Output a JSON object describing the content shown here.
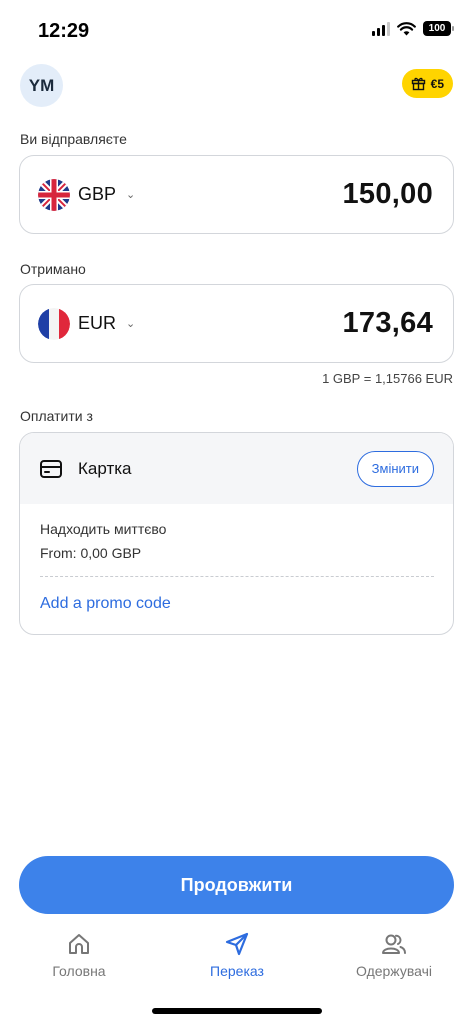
{
  "status_bar": {
    "time": "12:29",
    "battery": "100"
  },
  "header": {
    "avatar_initials": "YM",
    "reward_amount": "€5"
  },
  "send": {
    "label": "Ви відправляєте",
    "currency": "GBP",
    "amount": "150,00"
  },
  "receive": {
    "label": "Отримано",
    "currency": "EUR",
    "amount": "173,64"
  },
  "exchange_rate": "1 GBP = 1,15766 EUR",
  "payment": {
    "label": "Оплатити з",
    "method": "Картка",
    "change_label": "Змінити",
    "arrival": "Надходить миттєво",
    "min_amount": "From: 0,00 GBP",
    "promo_link": "Add a promo code"
  },
  "continue_label": "Продовжити",
  "nav": {
    "home": "Головна",
    "transfer": "Переказ",
    "recipients": "Одержувачі"
  },
  "colors": {
    "accent": "#3d82ea",
    "link": "#2d6cdf",
    "badge": "#ffd400"
  },
  "icons": [
    "signal-icon",
    "wifi-icon",
    "battery-icon",
    "gift-icon",
    "uk-flag-icon",
    "france-flag-icon",
    "chevron-down-icon",
    "card-icon",
    "home-icon",
    "send-icon",
    "recipients-icon"
  ]
}
